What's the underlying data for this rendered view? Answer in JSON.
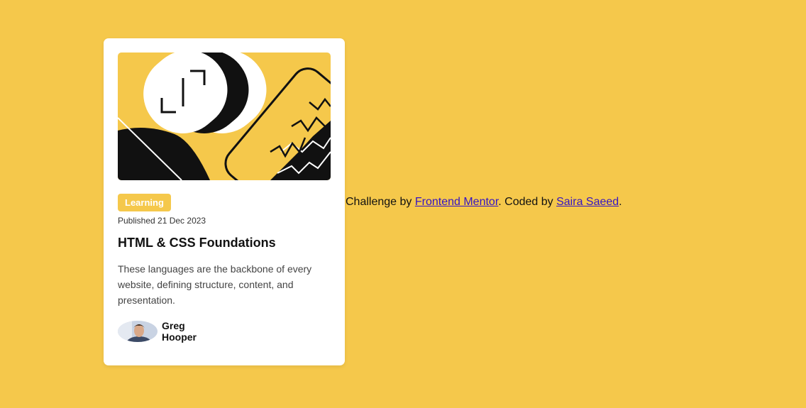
{
  "card": {
    "badge": "Learning",
    "published": "Published 21 Dec 2023",
    "title": "HTML & CSS Foundations",
    "description": "These languages are the backbone of every website, defining structure, content, and presentation.",
    "author": "Greg Hooper"
  },
  "attribution": {
    "prefix": "Challenge by",
    "mentor_link": "Frontend Mentor",
    "middle": ". Coded by",
    "author_link": "Saira Saeed",
    "suffix": "."
  },
  "colors": {
    "background": "#f5c84b",
    "card": "#ffffff",
    "text": "#121212",
    "link": "#3414c4"
  },
  "icons": {
    "hero": "abstract-illustration",
    "avatar": "person-photo"
  }
}
